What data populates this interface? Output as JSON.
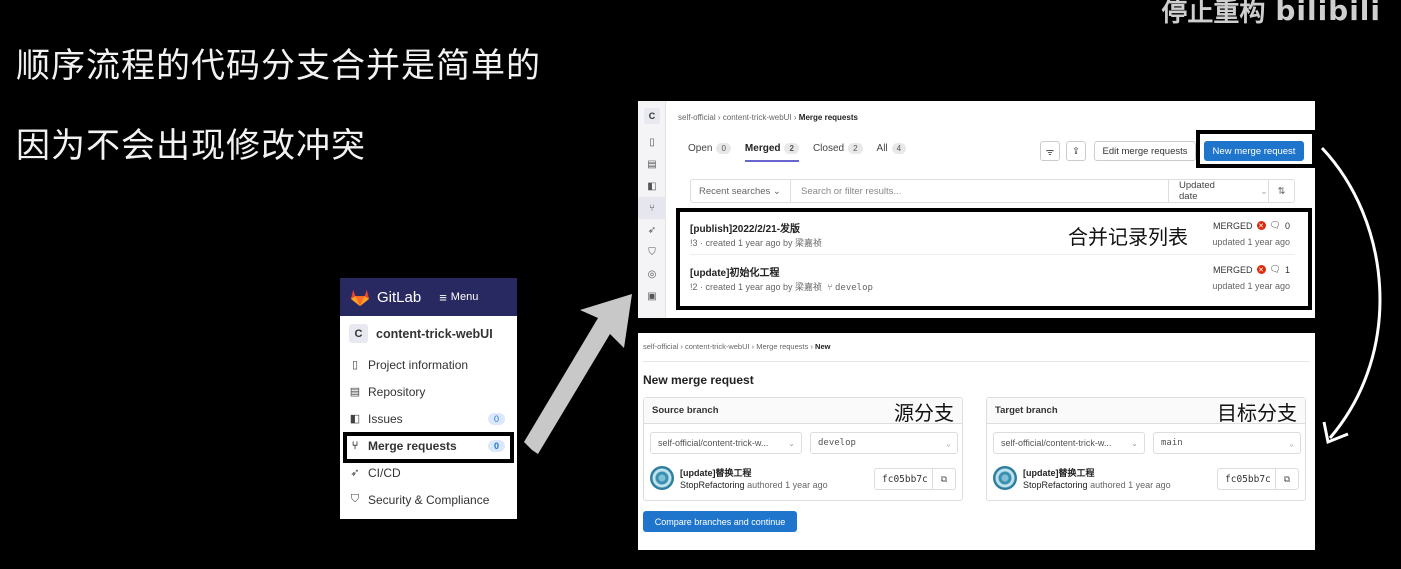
{
  "slide": {
    "line1": "顺序流程的代码分支合并是简单的",
    "line2": "因为不会出现修改冲突",
    "brand_text": "停止重构",
    "brand_logo": "bilibili"
  },
  "sidebar": {
    "app_name": "GitLab",
    "menu_label": "Menu",
    "project_avatar": "C",
    "project_name": "content-trick-webUI",
    "items": [
      {
        "label": "Project information",
        "icon": "info-icon"
      },
      {
        "label": "Repository",
        "icon": "document-icon"
      },
      {
        "label": "Issues",
        "icon": "issues-icon",
        "count": "0"
      },
      {
        "label": "Merge requests",
        "icon": "merge-request-icon",
        "count": "0"
      },
      {
        "label": "CI/CD",
        "icon": "rocket-icon"
      },
      {
        "label": "Security & Compliance",
        "icon": "shield-icon"
      }
    ]
  },
  "mr_list": {
    "breadcrumb": [
      "self-official",
      "content-trick-webUI",
      "Merge requests"
    ],
    "tabs": [
      {
        "label": "Open",
        "count": "0"
      },
      {
        "label": "Merged",
        "count": "2"
      },
      {
        "label": "Closed",
        "count": "2"
      },
      {
        "label": "All",
        "count": "4"
      }
    ],
    "edit_button": "Edit merge requests",
    "new_button": "New merge request",
    "recent_searches": "Recent searches",
    "search_placeholder": "Search or filter results...",
    "sort_label": "Updated date",
    "annotation": "合并记录列表",
    "rows": [
      {
        "title": "[publish]2022/2/21-发版",
        "sub": "!3 · created 1 year ago by 梁嘉祯",
        "branch": "",
        "status": "MERGED",
        "comments": "0",
        "updated": "updated 1 year ago"
      },
      {
        "title": "[update]初始化工程",
        "sub": "!2 · created 1 year ago by 梁嘉祯",
        "branch": "develop",
        "status": "MERGED",
        "comments": "1",
        "updated": "updated 1 year ago"
      }
    ]
  },
  "mr_new": {
    "breadcrumb": [
      "self-official",
      "content-trick-webUI",
      "Merge requests",
      "New"
    ],
    "title": "New merge request",
    "source": {
      "header": "Source branch",
      "annotation": "源分支",
      "project": "self-official/content-trick-w...",
      "branch": "develop",
      "commit_msg": "[update]替换工程",
      "author": "StopRefactoring",
      "authored": "authored 1 year ago",
      "sha": "fc05bb7c"
    },
    "target": {
      "header": "Target branch",
      "annotation": "目标分支",
      "project": "self-official/content-trick-w...",
      "branch": "main",
      "commit_msg": "[update]替换工程",
      "author": "StopRefactoring",
      "authored": "authored 1 year ago",
      "sha": "fc05bb7c"
    },
    "compare_button": "Compare branches and continue"
  },
  "colors": {
    "gitlab_header": "#292961",
    "primary_blue": "#1f75cb",
    "merged_red": "#dd2b0e",
    "background": "#000000"
  }
}
